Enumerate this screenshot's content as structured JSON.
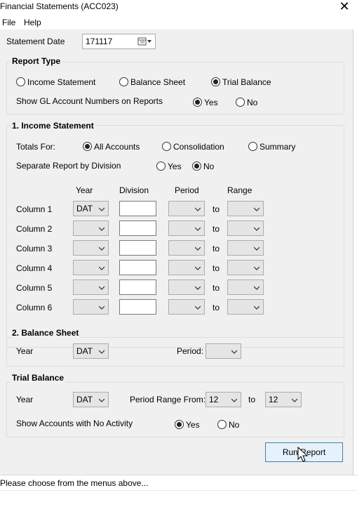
{
  "window": {
    "title": "Financial Statements (ACC023)",
    "close_glyph": "✕"
  },
  "menu": {
    "items": [
      "File",
      "Help"
    ]
  },
  "statement_date": {
    "label": "Statement Date",
    "value": "171117",
    "icon": "calendar-icon"
  },
  "report_type": {
    "title": "Report Type",
    "options": [
      "Income Statement",
      "Balance Sheet",
      "Trial Balance"
    ],
    "selected": "Trial Balance",
    "gl_label": "Show GL Account Numbers on Reports",
    "gl_options": [
      "Yes",
      "No"
    ],
    "gl_selected": "Yes"
  },
  "income_statement": {
    "title": "1.  Income Statement",
    "totals_label": "Totals For:",
    "totals_options": [
      "All Accounts",
      "Consolidation",
      "Summary"
    ],
    "totals_selected": "All Accounts",
    "separate_label": "Separate Report by Division",
    "separate_options": [
      "Yes",
      "No"
    ],
    "separate_selected": "No",
    "headers": [
      "Year",
      "Division",
      "Period",
      "Range"
    ],
    "to_label": "to",
    "rows": [
      {
        "label": "Column 1",
        "year": "DAT",
        "division": "",
        "period": "",
        "range": ""
      },
      {
        "label": "Column 2",
        "year": "",
        "division": "",
        "period": "",
        "range": ""
      },
      {
        "label": "Column 3",
        "year": "",
        "division": "",
        "period": "",
        "range": ""
      },
      {
        "label": "Column 4",
        "year": "",
        "division": "",
        "period": "",
        "range": ""
      },
      {
        "label": "Column 5",
        "year": "",
        "division": "",
        "period": "",
        "range": ""
      },
      {
        "label": "Column 6",
        "year": "",
        "division": "",
        "period": "",
        "range": ""
      }
    ]
  },
  "balance_sheet": {
    "title": "2.  Balance Sheet",
    "year_label": "Year",
    "year_value": "DAT",
    "period_label": "Period:",
    "period_value": ""
  },
  "trial_balance": {
    "title": "Trial Balance",
    "year_label": "Year",
    "year_value": "DAT",
    "range_from_label": "Period Range From:",
    "from_value": "12",
    "to_label": "to",
    "to_value": "12",
    "activity_label": "Show Accounts with No Activity",
    "activity_options": [
      "Yes",
      "No"
    ],
    "activity_selected": "Yes"
  },
  "run_button": {
    "label": "Run Report"
  },
  "status": {
    "text": "Please choose from the menus above..."
  }
}
